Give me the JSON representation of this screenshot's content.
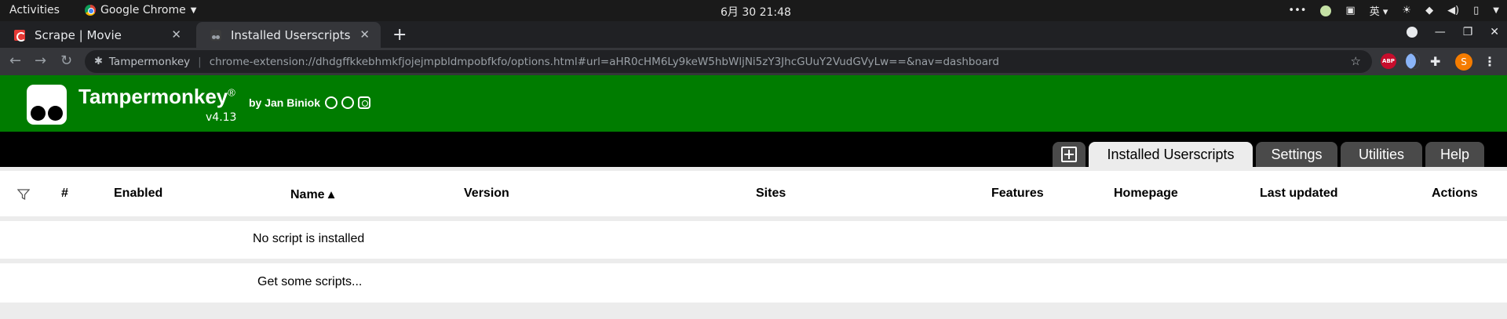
{
  "topbar": {
    "activities": "Activities",
    "app_name": "Google Chrome",
    "clock": "6月 30  21:48",
    "input_method": "英"
  },
  "tabs": [
    {
      "label": "Scrape | Movie"
    },
    {
      "label": "Installed Userscripts"
    }
  ],
  "omnibox": {
    "origin": "Tampermonkey",
    "url": "chrome-extension://dhdgffkkebhmkfjojejmpbldmpobfkfo/options.html#url=aHR0cHM6Ly9keW5hbWljNi5zY3JhcGUuY2VudGVyLw==&nav=dashboard"
  },
  "extensions": {
    "abp": "ABP",
    "avatar": "S"
  },
  "header": {
    "title": "Tampermonkey",
    "registered": "®",
    "version": "v4.13",
    "author": "by Jan Biniok"
  },
  "nav_tabs": {
    "installed": "Installed Userscripts",
    "settings": "Settings",
    "utilities": "Utilities",
    "help": "Help"
  },
  "table": {
    "columns": {
      "number": "#",
      "enabled": "Enabled",
      "name": "Name ▴",
      "version": "Version",
      "sites": "Sites",
      "features": "Features",
      "homepage": "Homepage",
      "last_updated": "Last updated",
      "actions": "Actions"
    },
    "empty_message": "No script is installed",
    "get_scripts": "Get some scripts..."
  },
  "colors": {
    "header_green": "#007c00",
    "nav_black": "#000000",
    "tab_gray": "#4a4a4a"
  }
}
